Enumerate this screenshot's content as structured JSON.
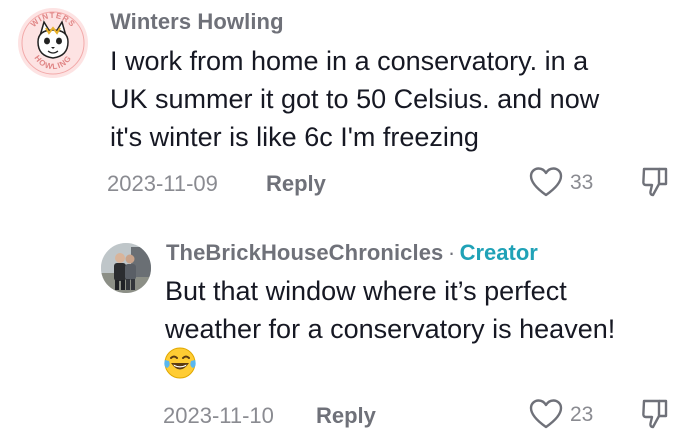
{
  "comment": {
    "avatar": {
      "icon": "winters-howling-cat-logo-icon",
      "logo_text_top": "WINTERS",
      "logo_text_bottom": "HOWLING"
    },
    "username": "Winters Howling",
    "text_lines": [
      "I work from home in a conservatory. in a",
      "UK summer it got to 50 Celsius. and now",
      "it's winter is like 6c I'm freezing"
    ],
    "date": "2023-11-09",
    "reply_label": "Reply",
    "like_count": "33",
    "like_icon": "heart-outline-icon",
    "dislike_icon": "thumbs-down-icon"
  },
  "reply": {
    "avatar": {
      "icon": "photo-avatar"
    },
    "username": "TheBrickHouseChronicles",
    "separator": "·",
    "badge": "Creator",
    "text_lines": [
      "But that window where it’s perfect",
      "weather for a conservatory is heaven!"
    ],
    "emoji": "😂",
    "date": "2023-11-10",
    "reply_label": "Reply",
    "like_count": "23",
    "like_icon": "heart-outline-icon",
    "dislike_icon": "thumbs-down-icon"
  },
  "colors": {
    "text": "#161823",
    "muted": "#8a8b91",
    "username": "#6f7179",
    "creator": "#20a2b7",
    "avatar_bg": "#fde3e3"
  }
}
